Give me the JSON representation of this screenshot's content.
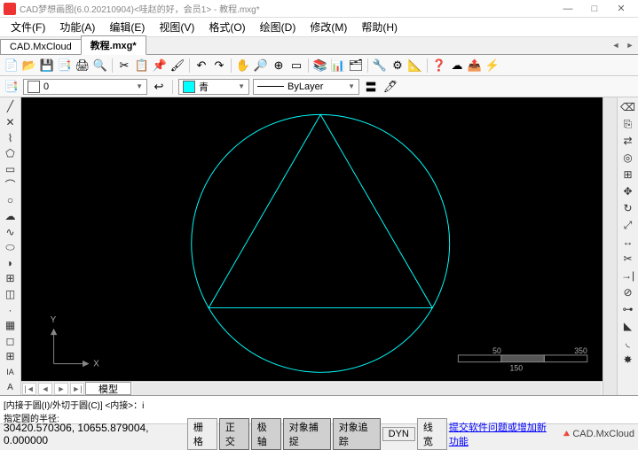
{
  "window": {
    "title": "CAD梦想画图(6.0.20210904)<哇赵的好，会员1> - 教程.mxg*",
    "min": "—",
    "max": "□",
    "close": "✕"
  },
  "menu": {
    "file": "文件(F)",
    "func": "功能(A)",
    "edit": "编辑(E)",
    "view": "视图(V)",
    "format": "格式(O)",
    "draw": "绘图(D)",
    "modify": "修改(M)",
    "help": "帮助(H)"
  },
  "tabs": {
    "t1": "CAD.MxCloud",
    "t2": "教程.mxg*"
  },
  "props": {
    "layer_value": "0",
    "color_name": "青",
    "linetype": "ByLayer"
  },
  "canvas": {
    "axis_x": "X",
    "axis_y": "Y",
    "scale_a": "50",
    "scale_b": "150",
    "scale_c": "350"
  },
  "model_tab": "模型",
  "cmd": {
    "line1": "[内接于圆(I)/外切于圆(C)] <内接>：i",
    "line2": "指定圆的半径:"
  },
  "status": {
    "coords": "30420.570306, 10655.879004, 0.000000",
    "grid": "栅格",
    "ortho": "正交",
    "polar": "极轴",
    "osnap": "对象捕捉",
    "otrack": "对象追踪",
    "dyn": "DYN",
    "lwt": "线宽",
    "feedback": "提交软件问题或增加新功能",
    "brand": "CAD.MxCloud"
  }
}
